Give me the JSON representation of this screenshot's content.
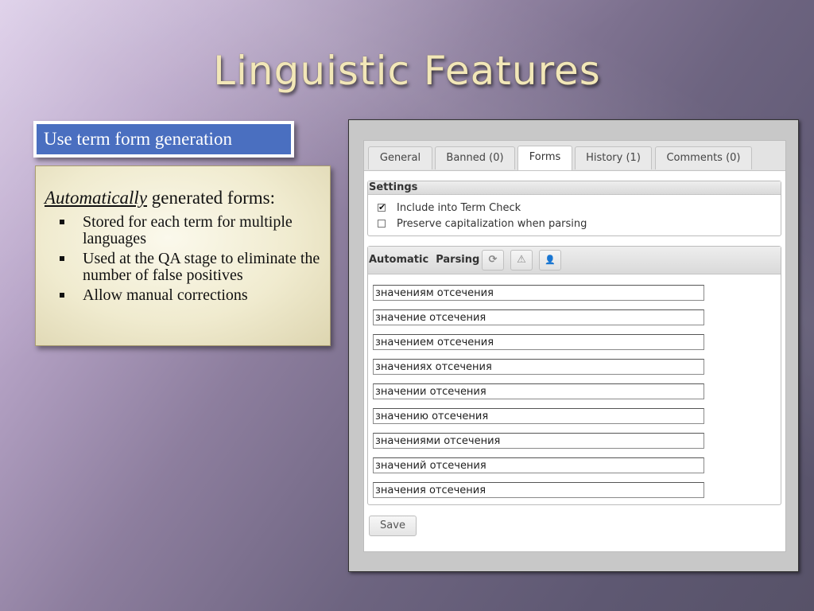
{
  "slide": {
    "title": "Linguistic Features",
    "label": "Use term form generation",
    "lead_em": "Automatically",
    "lead_rest": " generated forms:",
    "bullets": [
      "Stored for each term for multiple languages",
      "Used at the QA stage to eliminate the number of false positives",
      "Allow manual corrections"
    ]
  },
  "app": {
    "tabs": [
      {
        "label": "General",
        "active": false
      },
      {
        "label": "Banned (0)",
        "active": false
      },
      {
        "label": "Forms",
        "active": true
      },
      {
        "label": "History (1)",
        "active": false
      },
      {
        "label": "Comments (0)",
        "active": false
      }
    ],
    "settings": {
      "title": "Settings",
      "options": [
        {
          "label": "Include into Term Check",
          "checked": true
        },
        {
          "label": "Preserve capitalization when parsing",
          "checked": false
        }
      ]
    },
    "parsing": {
      "title": "Automatic  Parsing",
      "buttons": [
        {
          "icon": "refresh-icon",
          "glyph": "⟳"
        },
        {
          "icon": "warning-icon",
          "glyph": "⚠"
        },
        {
          "icon": "user-icon",
          "glyph": "👤"
        }
      ],
      "forms": [
        "значениям отсечения",
        "значение отсечения",
        "значением отсечения",
        "значениях отсечения",
        "значении отсечения",
        "значению отсечения",
        "значениями отсечения",
        "значений отсечения",
        "значения отсечения"
      ]
    },
    "save_label": "Save"
  },
  "colors": {
    "label_bg": "#4a6fc0",
    "title_color": "#f2e7b8",
    "textbox_bg": "#f0ebcf"
  }
}
